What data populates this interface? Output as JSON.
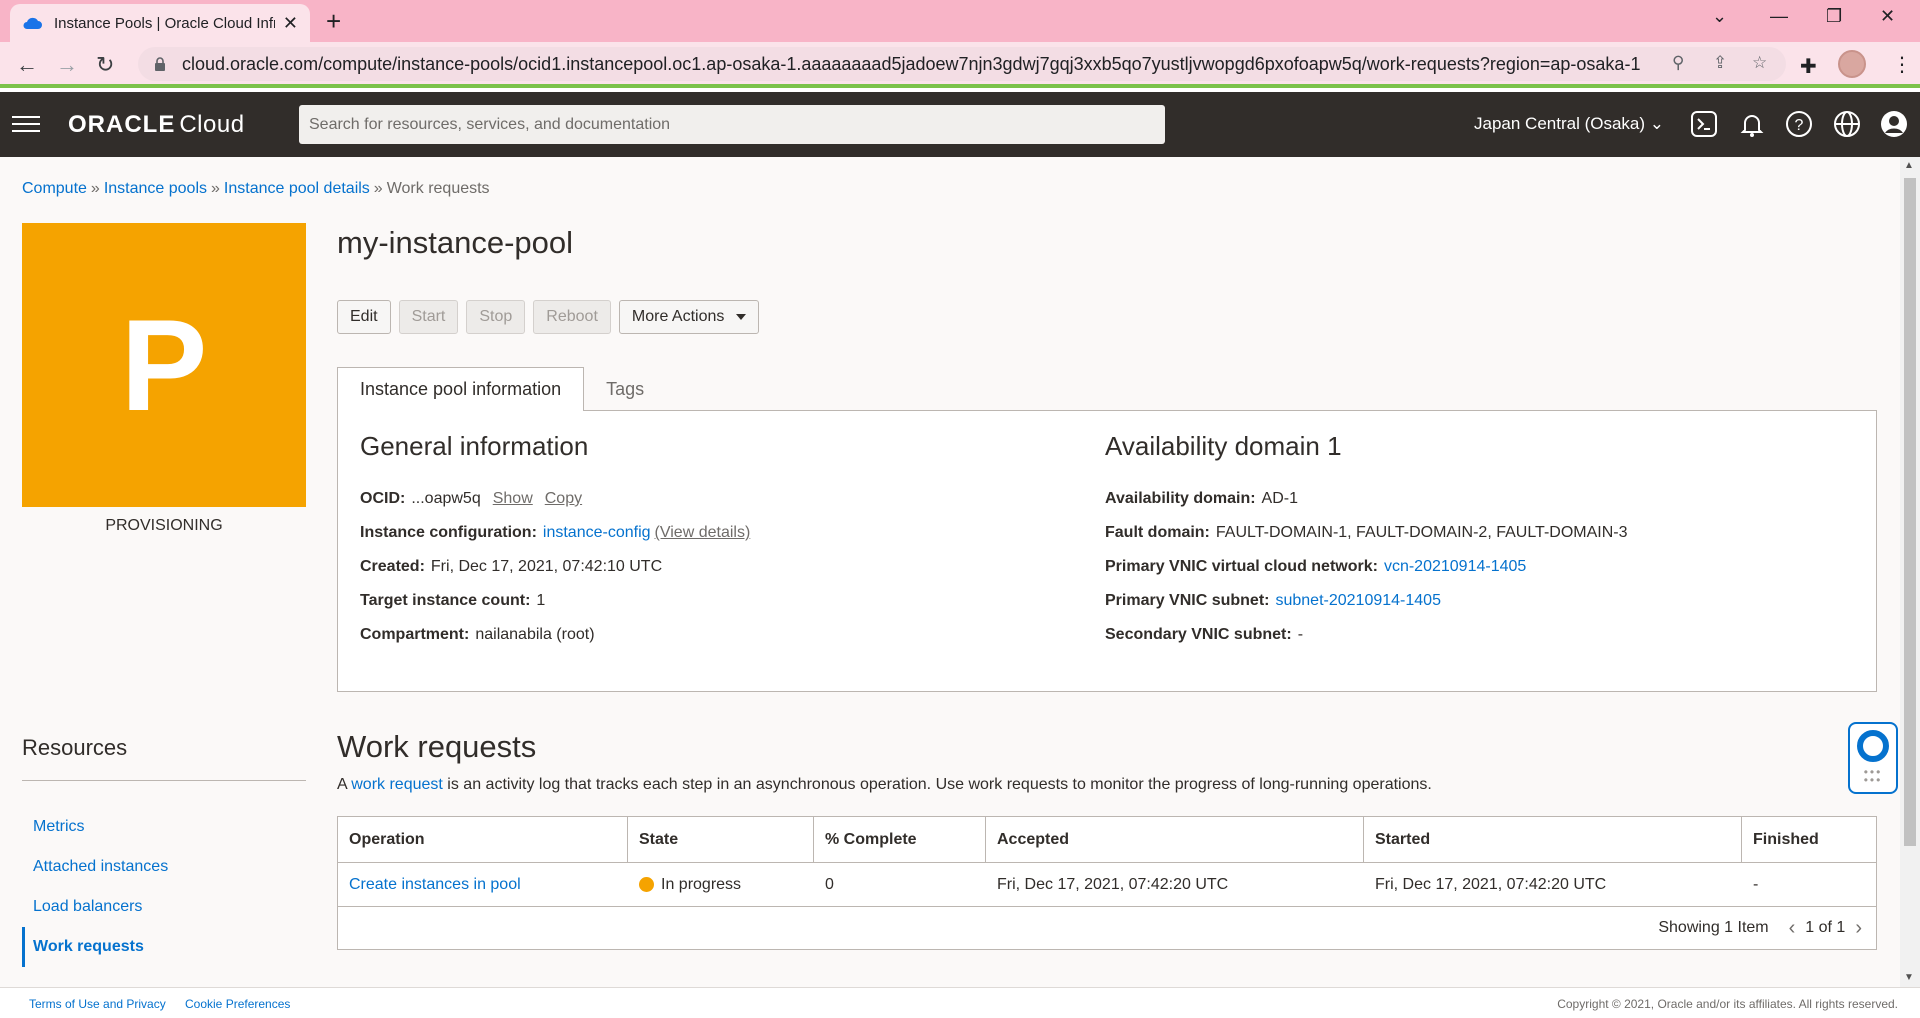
{
  "browser": {
    "tab_title": "Instance Pools | Oracle Cloud Infr",
    "url": "cloud.oracle.com/compute/instance-pools/ocid1.instancepool.oc1.ap-osaka-1.aaaaaaaad5jadoew7njn3gdwj7gqj3xxb5qo7yustljvwopgd6pxofoapw5q/work-requests?region=ap-osaka-1"
  },
  "header": {
    "brand_main": "ORACLE",
    "brand_sub": "Cloud",
    "search_placeholder": "Search for resources, services, and documentation",
    "region": "Japan Central (Osaka)"
  },
  "breadcrumb": [
    "Compute",
    "Instance pools",
    "Instance pool details",
    "Work requests"
  ],
  "pool": {
    "icon_letter": "P",
    "status": "PROVISIONING",
    "status_color": "#f5a300",
    "name": "my-instance-pool"
  },
  "actions": {
    "edit": "Edit",
    "start": "Start",
    "stop": "Stop",
    "reboot": "Reboot",
    "more": "More Actions"
  },
  "tabs": {
    "info": "Instance pool information",
    "tags": "Tags"
  },
  "general": {
    "heading": "General information",
    "ocid_label": "OCID:",
    "ocid_value": "...oapw5q",
    "show": "Show",
    "copy": "Copy",
    "config_label": "Instance configuration:",
    "config_value": "instance-config",
    "config_details": "(View details)",
    "created_label": "Created:",
    "created_value": "Fri, Dec 17, 2021, 07:42:10 UTC",
    "count_label": "Target instance count:",
    "count_value": "1",
    "compartment_label": "Compartment:",
    "compartment_value": "nailanabila (root)"
  },
  "availability": {
    "heading": "Availability domain 1",
    "ad_label": "Availability domain:",
    "ad_value": "AD-1",
    "fd_label": "Fault domain:",
    "fd_value": "FAULT-DOMAIN-1, FAULT-DOMAIN-2, FAULT-DOMAIN-3",
    "vcn_label": "Primary VNIC virtual cloud network:",
    "vcn_value": "vcn-20210914-1405",
    "subnet_label": "Primary VNIC subnet:",
    "subnet_value": "subnet-20210914-1405",
    "secondary_label": "Secondary VNIC subnet:",
    "secondary_value": "-"
  },
  "resources": {
    "heading": "Resources",
    "items": [
      "Metrics",
      "Attached instances",
      "Load balancers",
      "Work requests"
    ]
  },
  "work_requests": {
    "heading": "Work requests",
    "desc_prefix": "A",
    "desc_link": "work request",
    "desc_suffix": "is an activity log that tracks each step in an asynchronous operation. Use work requests to monitor the progress of long-running operations.",
    "columns": [
      "Operation",
      "State",
      "% Complete",
      "Accepted",
      "Started",
      "Finished"
    ],
    "rows": [
      {
        "operation": "Create instances in pool",
        "state": "In progress",
        "complete": "0",
        "accepted": "Fri, Dec 17, 2021, 07:42:20 UTC",
        "started": "Fri, Dec 17, 2021, 07:42:20 UTC",
        "finished": "-"
      }
    ],
    "showing": "Showing 1 Item",
    "page": "1 of 1"
  },
  "footer": {
    "terms": "Terms of Use and Privacy",
    "cookies": "Cookie Preferences",
    "copyright": "Copyright © 2021, Oracle and/or its affiliates. All rights reserved."
  }
}
